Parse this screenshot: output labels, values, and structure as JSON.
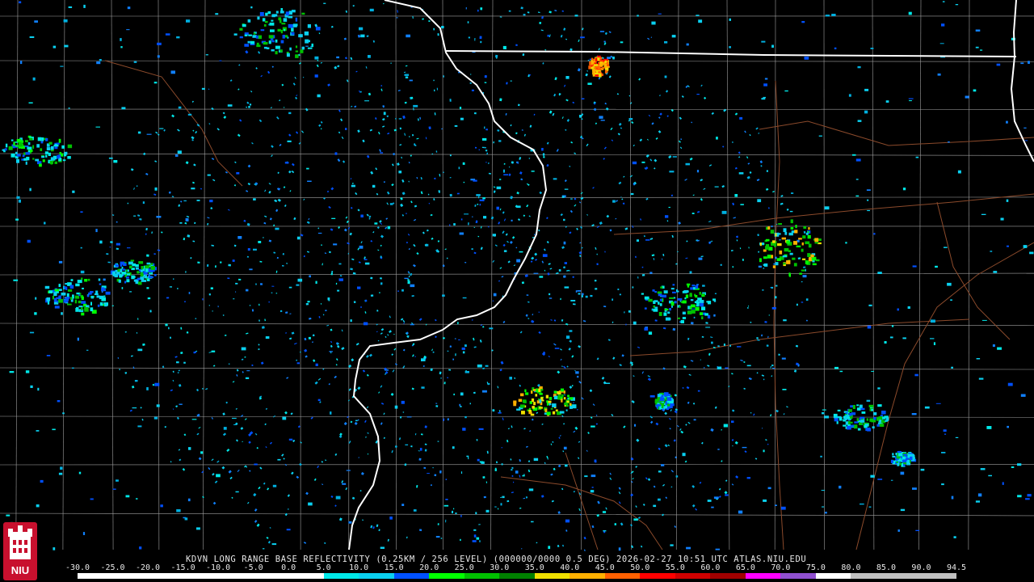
{
  "product": {
    "caption": "KDVN LONG RANGE BASE REFLECTIVITY (0.25KM / 256 LEVEL) (000000/0000 0.5 DEG) 2026-02-27 10:51 UTC  ATLAS.NIU.EDU"
  },
  "logo": {
    "text": "NIU",
    "color": "#c8102e"
  },
  "colorbar": {
    "ticks": [
      "-30.0",
      "-25.0",
      "-20.0",
      "-15.0",
      "-10.0",
      "-5.0",
      "0.0",
      "5.0",
      "10.0",
      "15.0",
      "20.0",
      "25.0",
      "30.0",
      "35.0",
      "40.0",
      "45.0",
      "50.0",
      "55.0",
      "60.0",
      "65.0",
      "70.0",
      "75.0",
      "80.0",
      "85.0",
      "90.0",
      "94.5"
    ],
    "colors": [
      "#ffffff",
      "#ffffff",
      "#ffffff",
      "#ffffff",
      "#ffffff",
      "#ffffff",
      "#ffffff",
      "#00e8e8",
      "#0ad0f0",
      "#0050ff",
      "#00ff00",
      "#00c000",
      "#008000",
      "#f0e000",
      "#ffb000",
      "#ff6000",
      "#ff0000",
      "#d00000",
      "#a00000",
      "#ff00ff",
      "#9050d0",
      "#ffffff",
      "#c0c0c0",
      "#c0c0c0",
      "#c0c0c0"
    ]
  },
  "map": {
    "river_color": "#ffffff",
    "border_color": "#ffffff",
    "county_color": "#a0a0a0",
    "road_color": "#8b4a2b",
    "radar_site": "KDVN"
  }
}
